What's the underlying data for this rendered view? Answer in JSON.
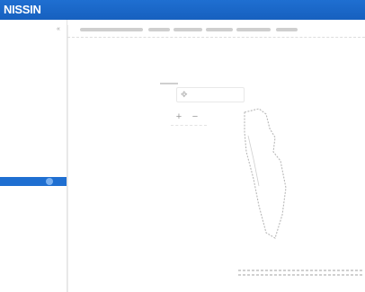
{
  "header": {
    "logo_text": "NISSIN",
    "bar_color": "#1f6fd1"
  },
  "sidebar": {
    "collapse_icon": "chevron-left-icon",
    "items": [
      {
        "label": "",
        "style": "strong"
      },
      {
        "label": "",
        "style": "muted"
      },
      {
        "label": "",
        "style": "muted"
      },
      {
        "label": "",
        "style": "muted"
      },
      {
        "label": "",
        "style": "strong"
      },
      {
        "label": "",
        "style": "muted"
      },
      {
        "label": "",
        "style": "muted"
      },
      {
        "label": "",
        "style": "muted"
      },
      {
        "label": "",
        "style": "strong"
      },
      {
        "label": "",
        "style": "muted"
      },
      {
        "label": "",
        "style": "active"
      },
      {
        "label": "",
        "style": "muted"
      }
    ],
    "active_color": "#1f6fd1"
  },
  "main": {
    "tabs": [
      {
        "label": ""
      },
      {
        "label": ""
      },
      {
        "label": ""
      },
      {
        "label": ""
      },
      {
        "label": ""
      },
      {
        "label": ""
      }
    ],
    "sections": {
      "top_label": "",
      "add_option_label": "",
      "add_option_icon": "move-icon",
      "zoom_in_icon": "plus-icon",
      "zoom_out_icon": "minus-icon",
      "bottom_label": "",
      "footer_label": ""
    }
  }
}
